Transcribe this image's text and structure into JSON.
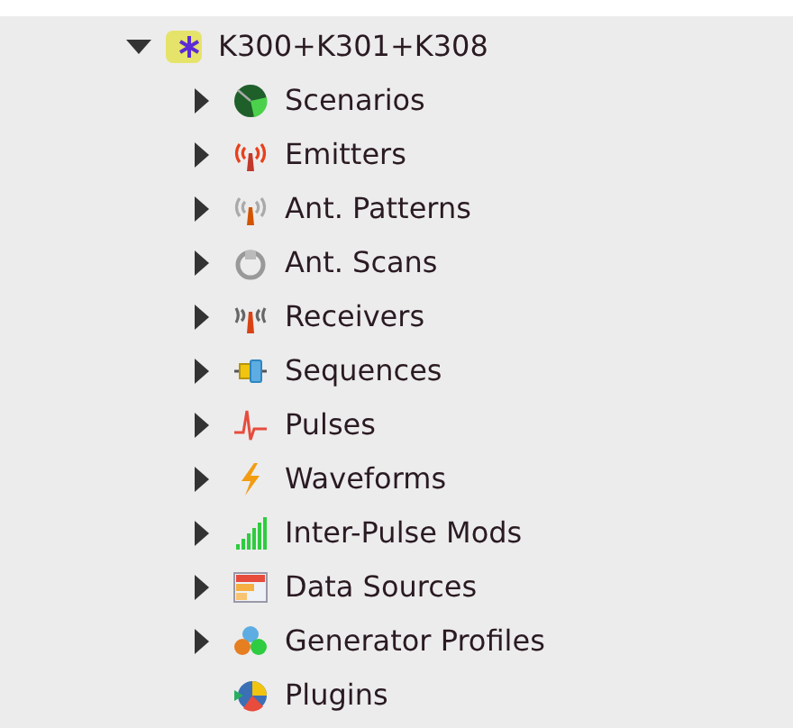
{
  "tree": {
    "label": "K300+K301+K308",
    "expanded": true,
    "children": [
      {
        "label": "Scenarios",
        "expandable": true
      },
      {
        "label": "Emitters",
        "expandable": true
      },
      {
        "label": "Ant. Patterns",
        "expandable": true
      },
      {
        "label": "Ant. Scans",
        "expandable": true
      },
      {
        "label": "Receivers",
        "expandable": true
      },
      {
        "label": "Sequences",
        "expandable": true
      },
      {
        "label": "Pulses",
        "expandable": true
      },
      {
        "label": "Waveforms",
        "expandable": true
      },
      {
        "label": "Inter-Pulse Mods",
        "expandable": true
      },
      {
        "label": "Data Sources",
        "expandable": true
      },
      {
        "label": "Generator Profiles",
        "expandable": true
      },
      {
        "label": "Plugins",
        "expandable": false
      }
    ]
  }
}
